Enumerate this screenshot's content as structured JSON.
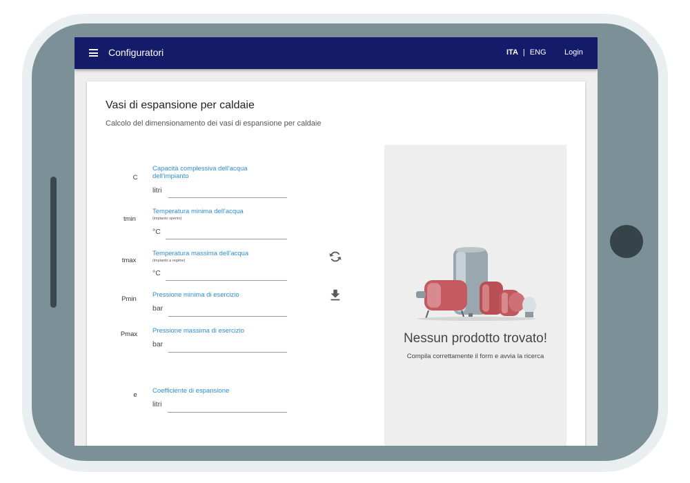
{
  "appbar": {
    "title": "Configuratori",
    "lang_active": "ITA",
    "lang_separator": "|",
    "lang_other": "ENG",
    "login": "Login",
    "color": "#141c6a"
  },
  "page": {
    "title": "Vasi di espansione per caldaie",
    "subtitle": "Calcolo del dimensionamento dei vasi di espansione per caldaie"
  },
  "fields": [
    {
      "symbol": "C",
      "label": "Capacità complessiva dell'acqua dell'impianto",
      "hint": "",
      "unit": "litri"
    },
    {
      "symbol": "tmin",
      "label": "Temperatura minima dell'acqua",
      "hint": "(impianto spento)",
      "unit": "°C"
    },
    {
      "symbol": "tmax",
      "label": "Temperatura massima dell'acqua",
      "hint": "(impianto a regime)",
      "unit": "°C"
    },
    {
      "symbol": "Pmin",
      "label": "Pressione minima di esercizio",
      "hint": "",
      "unit": "bar"
    },
    {
      "symbol": "Pmax",
      "label": "Pressione massima di esercizio",
      "hint": "",
      "unit": "bar"
    },
    {
      "symbol": "e",
      "label": "Coefficiente di espansione",
      "hint": "",
      "unit": "litri"
    }
  ],
  "actions": {
    "refresh_icon": "refresh-icon",
    "download_icon": "download-icon"
  },
  "result": {
    "empty_title": "Nessun prodotto trovato!",
    "empty_hint": "Compila correttamente il form e avvia la ricerca"
  },
  "colors": {
    "accent": "#2d8ecf",
    "panel": "#eeeeee"
  }
}
